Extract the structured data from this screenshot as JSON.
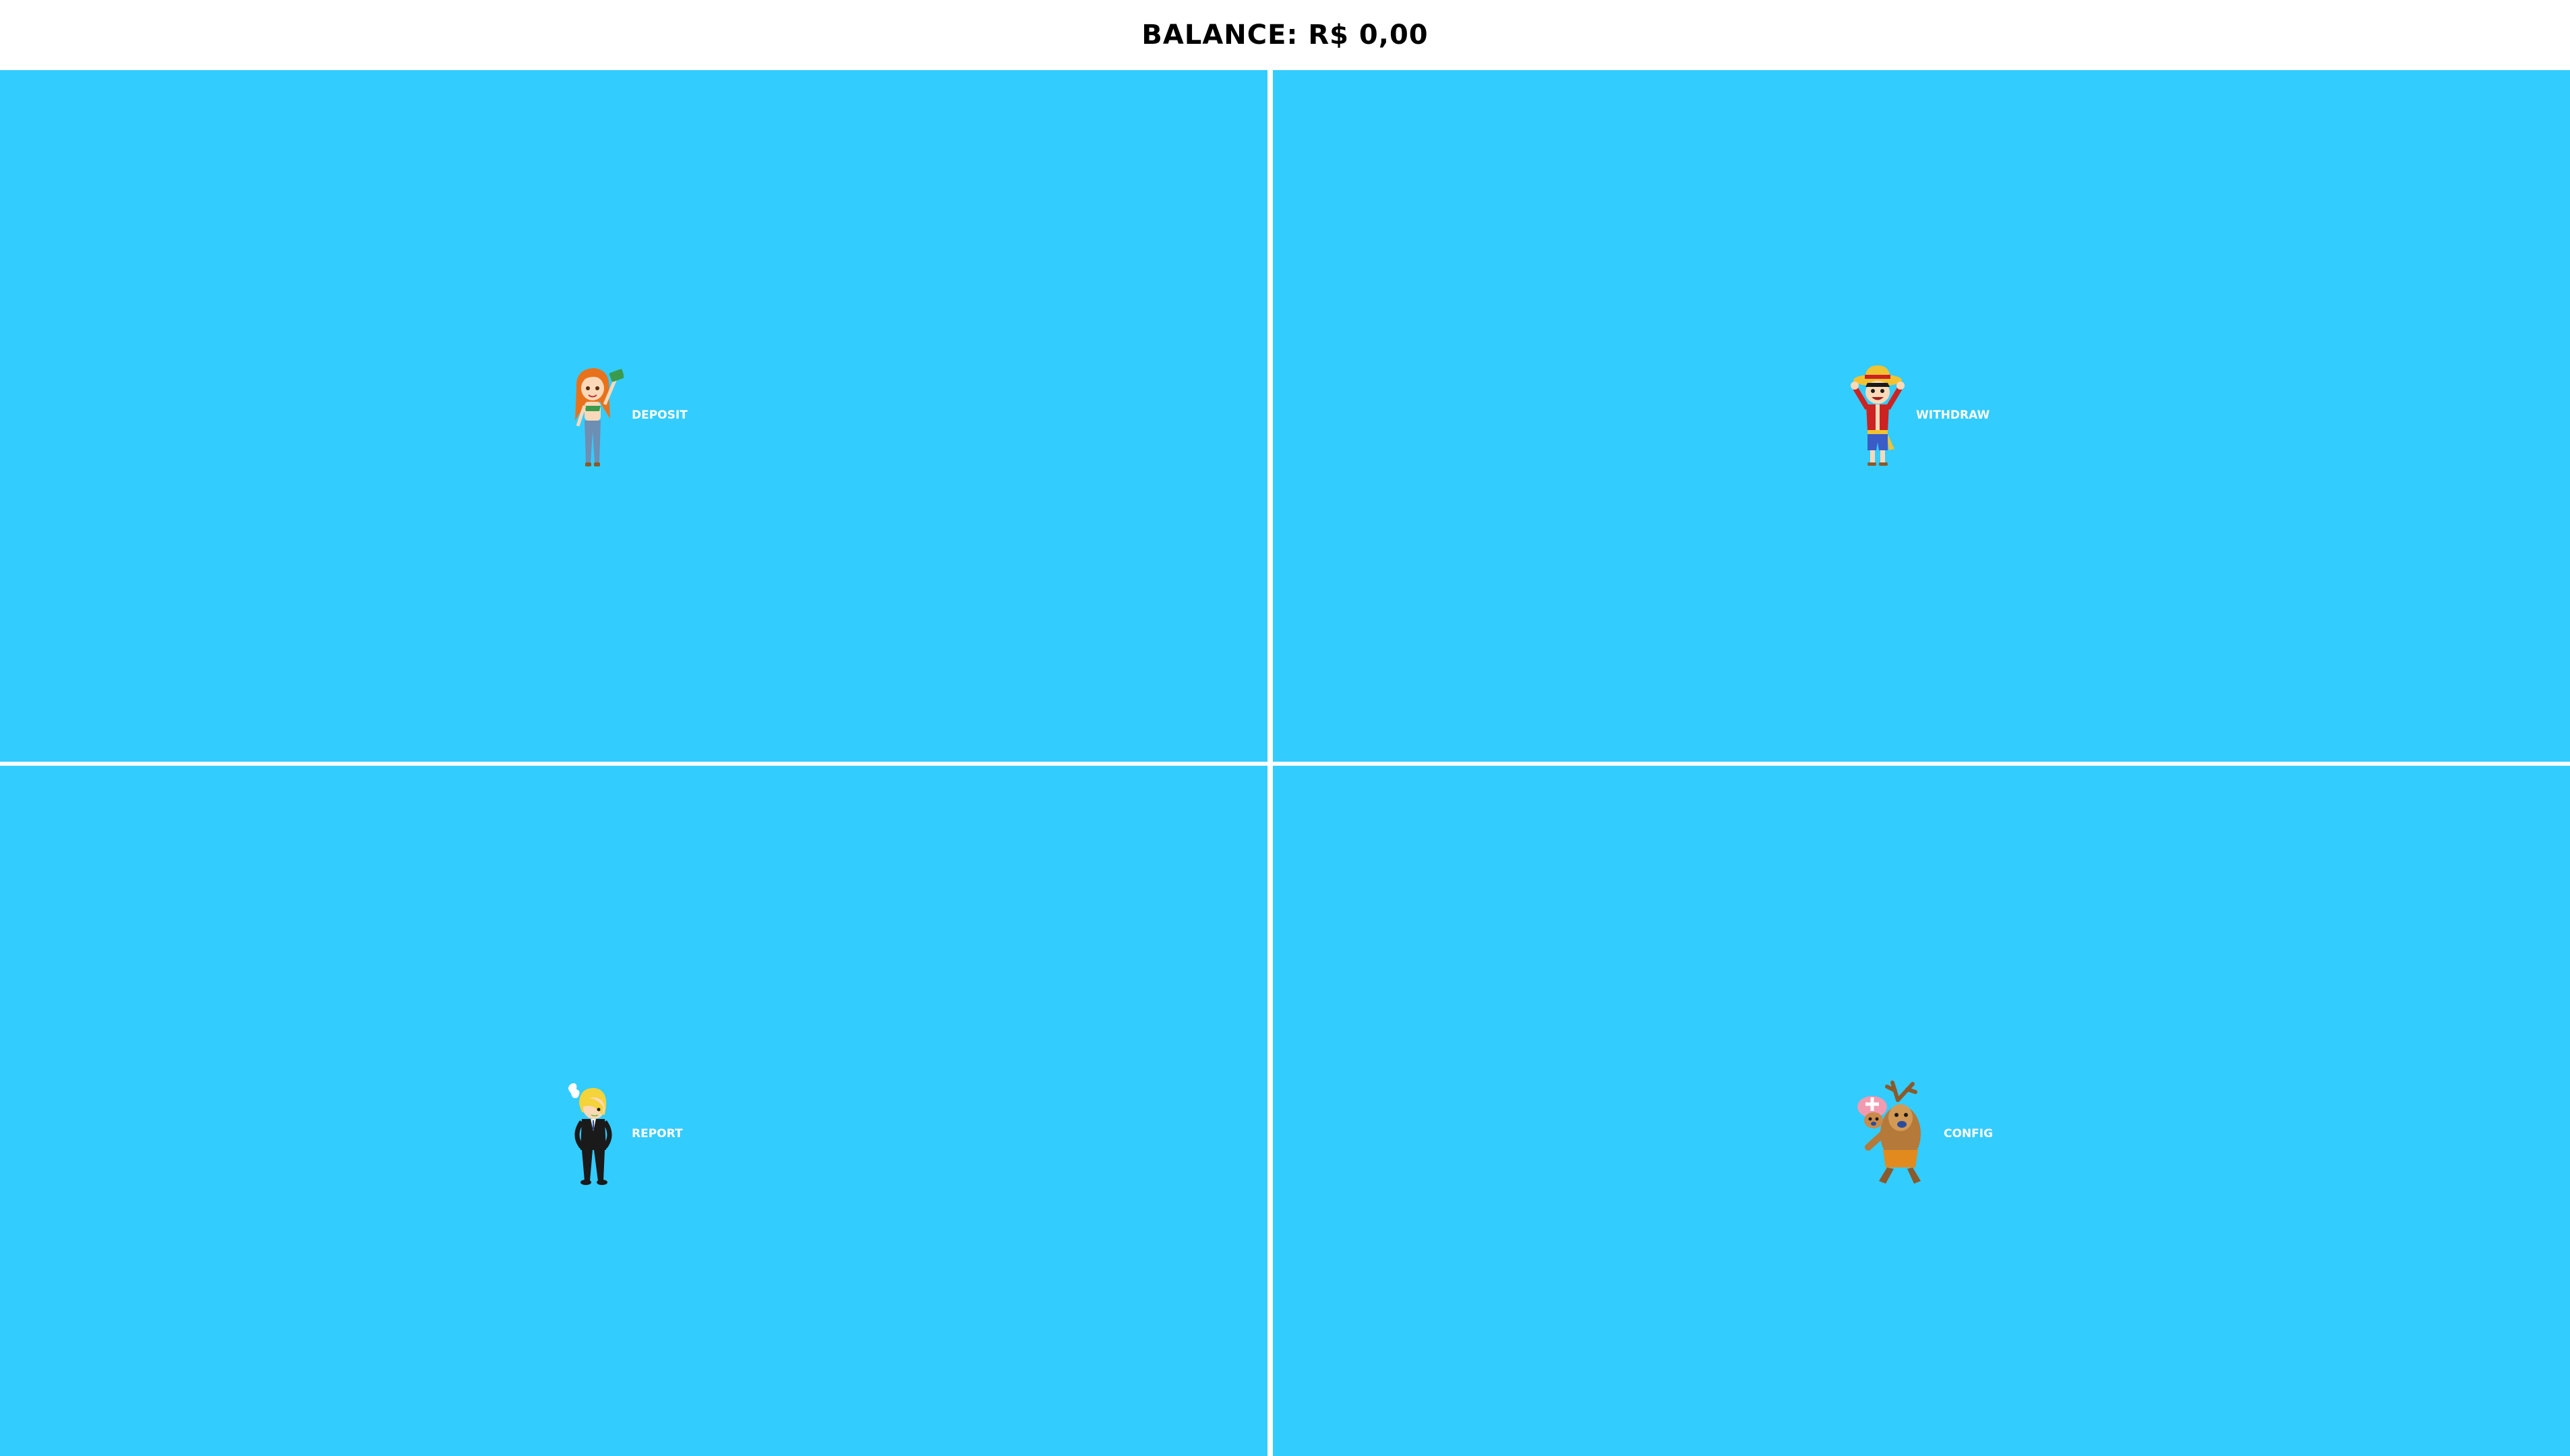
{
  "header": {
    "balance_text": "Balance: R$ 0,00"
  },
  "menu": {
    "items": [
      {
        "label": "Deposit",
        "icon": "nami-character-icon"
      },
      {
        "label": "Withdraw",
        "icon": "luffy-character-icon"
      },
      {
        "label": "Report",
        "icon": "sanji-character-icon"
      },
      {
        "label": "Config",
        "icon": "chopper-character-icon"
      }
    ]
  },
  "colors": {
    "tile_background": "#33ccff",
    "divider": "#ffffff",
    "label_text": "#ffffff",
    "header_text": "#000000"
  }
}
